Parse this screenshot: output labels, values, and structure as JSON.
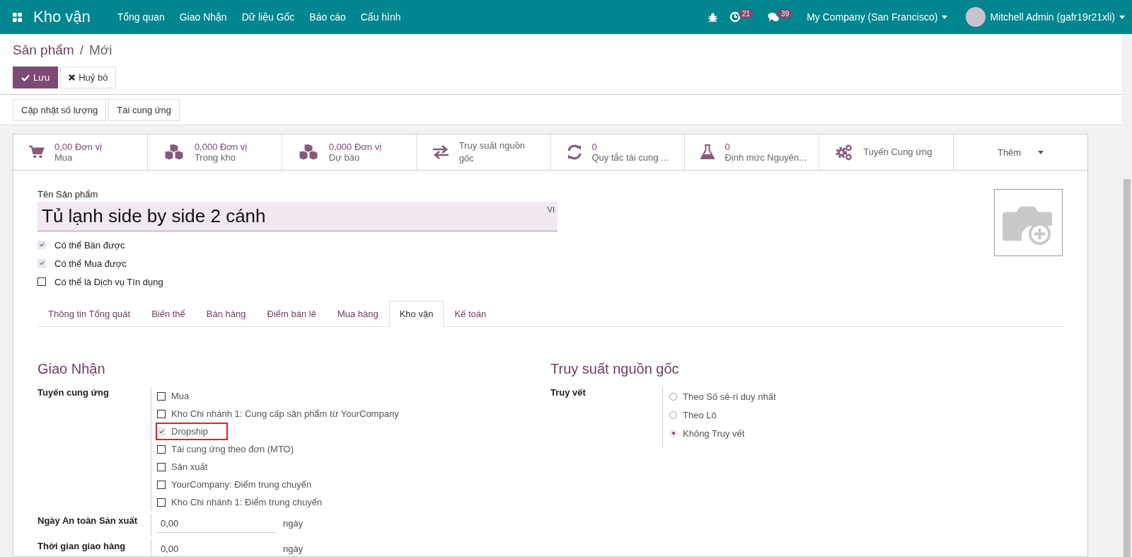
{
  "navbar": {
    "app_name": "Kho vận",
    "menu": [
      "Tổng quan",
      "Giao Nhận",
      "Dữ liệu Gốc",
      "Báo cáo",
      "Cấu hình"
    ],
    "activity_count": "21",
    "message_count": "39",
    "company": "My Company (San Francisco)",
    "user": "Mitchell Admin (gafr19r21xli)"
  },
  "breadcrumb": {
    "parent": "Sản phẩm",
    "separator": "/",
    "current": "Mới"
  },
  "buttons": {
    "save": "Lưu",
    "discard": "Huỷ bỏ"
  },
  "actions": [
    "Cập nhật số lượng",
    "Tái cung ứng"
  ],
  "smart_buttons": [
    {
      "kind": "stat",
      "value": "0,00 Đơn vị",
      "label": "Mua"
    },
    {
      "kind": "stat",
      "value": "0,000 Đơn vị",
      "label": "Trong kho"
    },
    {
      "kind": "stat",
      "value": "0,000 Đơn vị",
      "label": "Dự báo"
    },
    {
      "kind": "stat",
      "label": "Truy suất nguồn gốc"
    },
    {
      "kind": "stat",
      "value": "0",
      "label": "Quy tắc tái cung ..."
    },
    {
      "kind": "stat",
      "value": "0",
      "label": "Định mức Nguyên..."
    },
    {
      "kind": "stat",
      "label": "Tuyến Cung ứng"
    },
    {
      "kind": "more",
      "label": "Thêm"
    }
  ],
  "product": {
    "name_label": "Tên Sản phẩm",
    "name": "Tủ lạnh side by side 2 cánh",
    "language": "VI"
  },
  "options": [
    {
      "label": "Có thể Bán được",
      "checked": true
    },
    {
      "label": "Có thể Mua được",
      "checked": true
    },
    {
      "label": "Có thể là Dịch vụ Tín dụng",
      "checked": false
    }
  ],
  "tabs": [
    {
      "label": "Thông tin Tổng quát",
      "selected": false
    },
    {
      "label": "Biến thể",
      "selected": false
    },
    {
      "label": "Bán hàng",
      "selected": false
    },
    {
      "label": "Điểm bán lẻ",
      "selected": false
    },
    {
      "label": "Mua hàng",
      "selected": false
    },
    {
      "label": "Kho vận",
      "selected": true
    },
    {
      "label": "Kế toán",
      "selected": false
    }
  ],
  "operations": {
    "title": "Giao Nhận",
    "routes_label": "Tuyến cung ứng",
    "routes": [
      {
        "label": "Mua",
        "checked": false,
        "highlighted": false
      },
      {
        "label": "Kho Chi nhánh 1: Cung cấp sản phẩm từ YourCompany",
        "checked": false,
        "highlighted": false
      },
      {
        "label": "Dropship",
        "checked": true,
        "highlighted": true
      },
      {
        "label": "Tái cung ứng theo đơn (MTO)",
        "checked": false,
        "highlighted": false
      },
      {
        "label": "Sản xuất",
        "checked": false,
        "highlighted": false
      },
      {
        "label": "YourCompany: Điểm trung chuyển",
        "checked": false,
        "highlighted": false
      },
      {
        "label": "Kho Chi nhánh 1: Điểm trung chuyển",
        "checked": false,
        "highlighted": false
      }
    ],
    "fields": [
      {
        "label": "Ngày An toàn Sản xuất",
        "value": "0,00",
        "unit": "ngày"
      },
      {
        "label": "Thời gian giao hàng",
        "value": "0,00",
        "unit": "ngày"
      }
    ]
  },
  "traceability": {
    "title": "Truy suất nguồn gốc",
    "label": "Truy vết",
    "options": [
      {
        "label": "Theo Số sê-ri duy nhất",
        "selected": false
      },
      {
        "label": "Theo Lô",
        "selected": false
      },
      {
        "label": "Không Truy vết",
        "selected": true
      }
    ]
  }
}
